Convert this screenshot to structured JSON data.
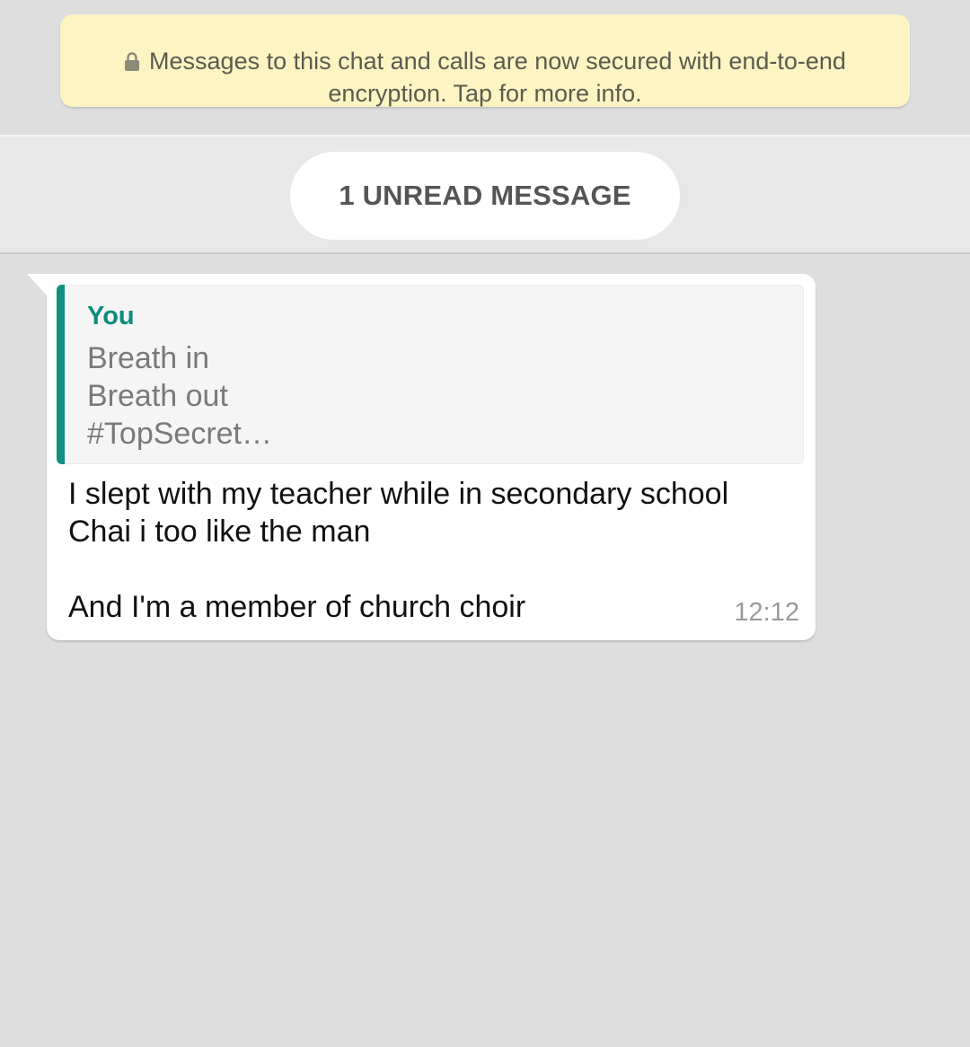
{
  "banner": {
    "line1": "Messages to this chat and calls are now secured with end-to-end",
    "line2": "encryption. Tap for more info.",
    "icon": "lock-icon"
  },
  "unread": {
    "label": "1 UNREAD MESSAGE"
  },
  "message": {
    "quote": {
      "author": "You",
      "lines": [
        "Breath in",
        "Breath out",
        "#TopSecret…"
      ]
    },
    "body_lines": [
      "I slept with my teacher while in secondary school",
      "Chai i too like the man",
      "",
      "And I'm a member of church choir"
    ],
    "time": "12:12"
  },
  "colors": {
    "background": "#dedede",
    "banner": "#fdf4c4",
    "quote_accent": "#129081",
    "quote_author": "#0d8b7e"
  }
}
